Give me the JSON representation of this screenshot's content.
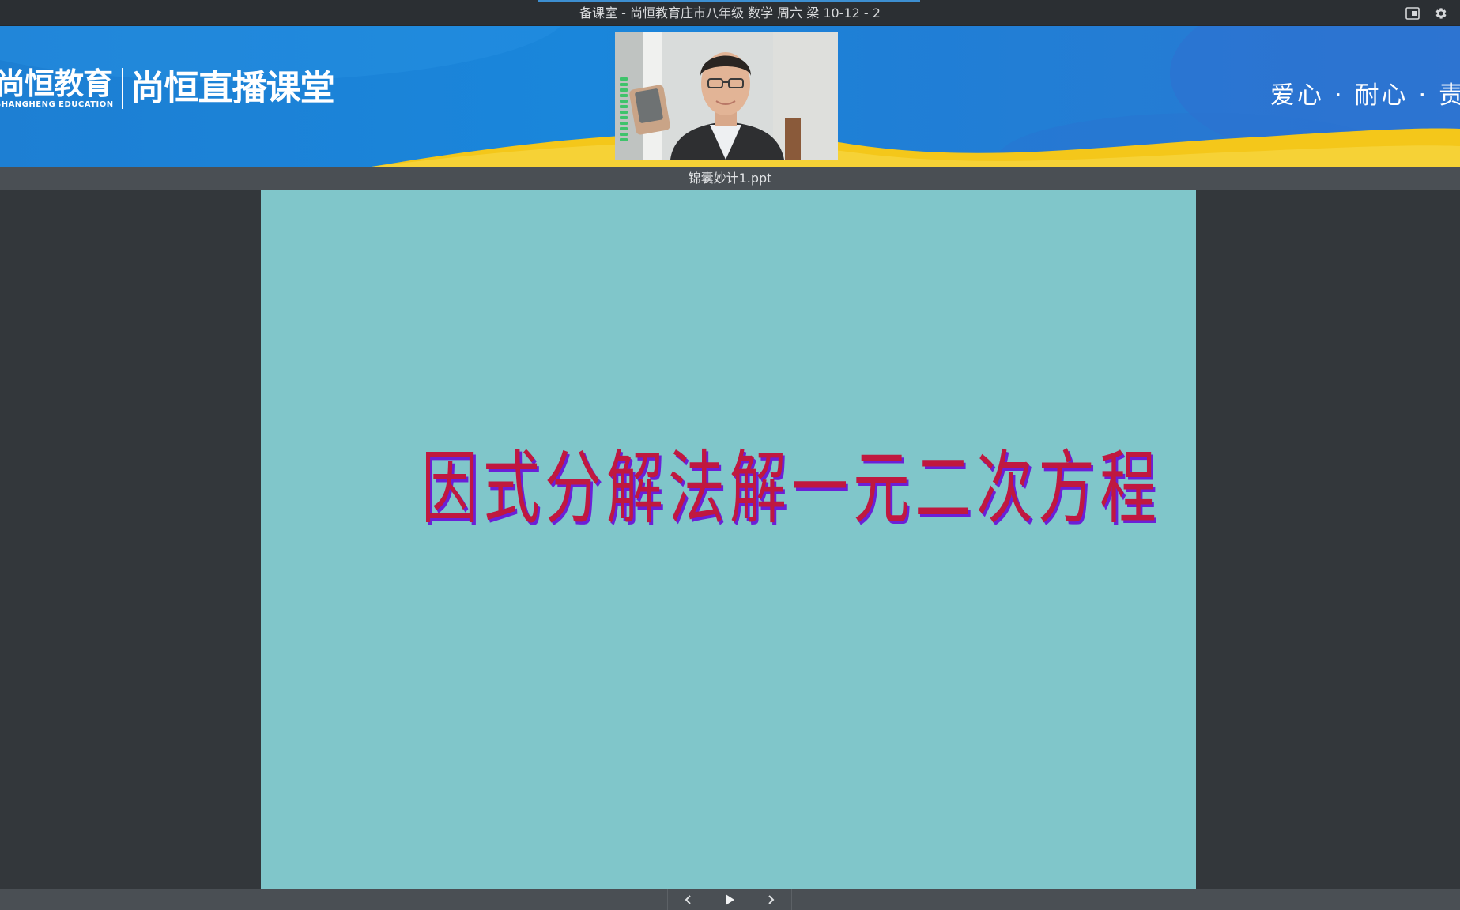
{
  "window": {
    "title": "备课室 - 尚恒教育庄市八年级 数学 周六 梁 10-12 - 2"
  },
  "banner": {
    "brand_name": "尚恒教育",
    "brand_english": "SHANGHENG EDUCATION",
    "product_name": "尚恒直播课堂",
    "slogan": "爱心 · 耐心 · 责"
  },
  "document": {
    "file_name": "锦囊妙计1.ppt"
  },
  "slide": {
    "title_chars": [
      "因",
      "式",
      "分",
      "解",
      "法",
      "解",
      "一",
      "元",
      "二",
      "次",
      "方",
      "程"
    ]
  },
  "colors": {
    "banner_blue": "#1a86db",
    "banner_yellow": "#f4c71a",
    "slide_background": "#80c6ca",
    "slide_title": "#c0183f",
    "slide_title_shadow": "#6b1fd8",
    "chrome_dark": "#2b2f33",
    "mic_level_green": "#3fc36b"
  },
  "icons": {
    "fullscreen": "picture-in-picture-icon",
    "settings": "gear-icon",
    "previous": "chevron-left-icon",
    "play": "play-icon",
    "next": "chevron-right-icon",
    "mic_level": "mic-level-icon"
  }
}
